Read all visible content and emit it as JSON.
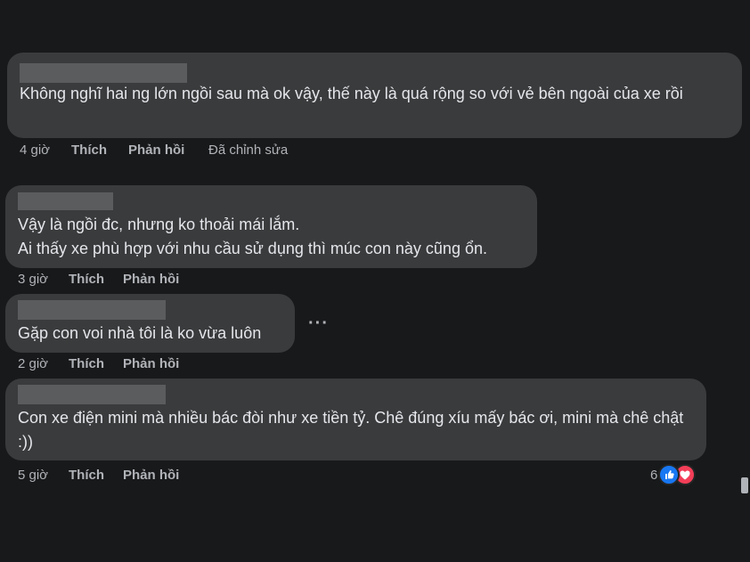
{
  "comments": [
    {
      "text": "Không nghĩ hai ng lớn ngồi sau mà ok vậy, thế này là quá rộng so với vẻ bên ngoài của xe rồi",
      "time": "4 giờ",
      "like": "Thích",
      "reply": "Phản hồi",
      "edited": "Đã chỉnh sửa"
    },
    {
      "text": "Vậy là ngồi đc, nhưng ko thoải mái lắm.\nAi thấy xe phù hợp với nhu cầu sử dụng thì múc con này cũng ổn.",
      "time": "3 giờ",
      "like": "Thích",
      "reply": "Phản hồi"
    },
    {
      "text": "Gặp con voi nhà tôi là ko vừa luôn",
      "time": "2 giờ",
      "like": "Thích",
      "reply": "Phản hồi"
    },
    {
      "text": "Con xe điện mini mà nhiều bác đòi như xe tiền tỷ. Chê đúng xíu mấy bác ơi, mini mà chê chật :))",
      "time": "5 giờ",
      "like": "Thích",
      "reply": "Phản hồi",
      "reaction_count": "6"
    }
  ],
  "more_options": "···",
  "colors": {
    "background": "#18191a",
    "bubble": "#3a3b3c",
    "text": "#e4e6eb",
    "secondary": "#b0b3b8",
    "like_blue": "#1877f2",
    "love_red": "#f33e58"
  },
  "icons": [
    "like-reaction-icon",
    "love-reaction-icon",
    "more-options-icon"
  ]
}
